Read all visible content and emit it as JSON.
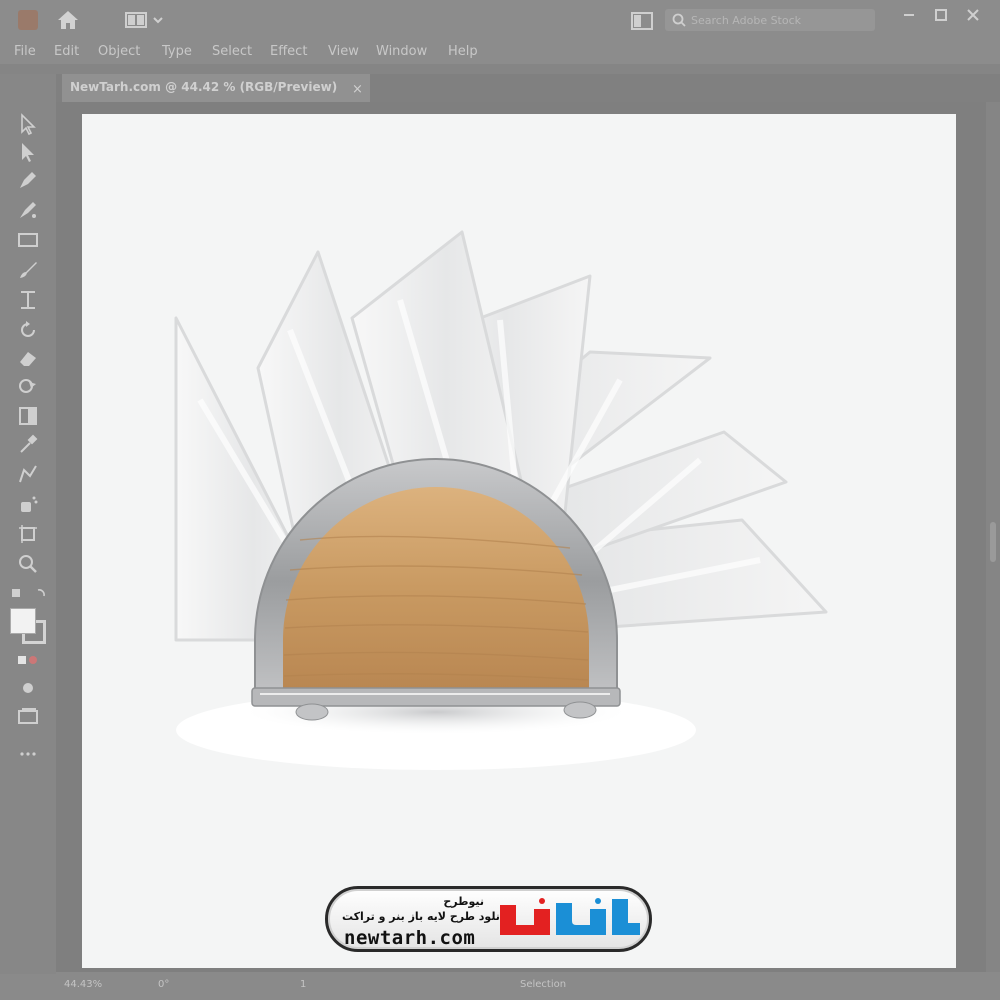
{
  "app": {
    "search_placeholder": "Search Adobe Stock",
    "menu": [
      "File",
      "Edit",
      "Object",
      "Type",
      "Select",
      "Effect",
      "View",
      "Window",
      "Help"
    ]
  },
  "document": {
    "tab_label": "NewTarh.com @ 44.42 % (RGB/Preview)",
    "close_glyph": "×"
  },
  "status": {
    "zoom": "44.43%",
    "rotation": "0°",
    "artboard_number": "1",
    "mode": "Selection"
  },
  "watermark": {
    "name_fa": "نیوطرح",
    "tagline_fa": "دانلود طرح لایه باز بنر و تراکت",
    "url": "newtarh.com"
  },
  "icons": {
    "toolbar": [
      "selection-tool-icon",
      "direct-selection-tool-icon",
      "pen-tool-icon",
      "curvature-tool-icon",
      "rectangle-tool-icon",
      "paintbrush-tool-icon",
      "width-tool-icon",
      "rotate-tool-icon",
      "eraser-tool-icon",
      "shape-builder-tool-icon",
      "gradient-tool-icon",
      "eyedropper-tool-icon",
      "blend-tool-icon",
      "symbol-sprayer-tool-icon",
      "artboard-tool-icon",
      "zoom-tool-icon"
    ]
  },
  "colors": {
    "chrome": "#8a8a8a",
    "artboard": "#f4f5f5",
    "wood": "#c99a62",
    "metal": "#a7a9ab",
    "logo_blue": "#1b8fd6",
    "logo_red": "#e32121"
  }
}
